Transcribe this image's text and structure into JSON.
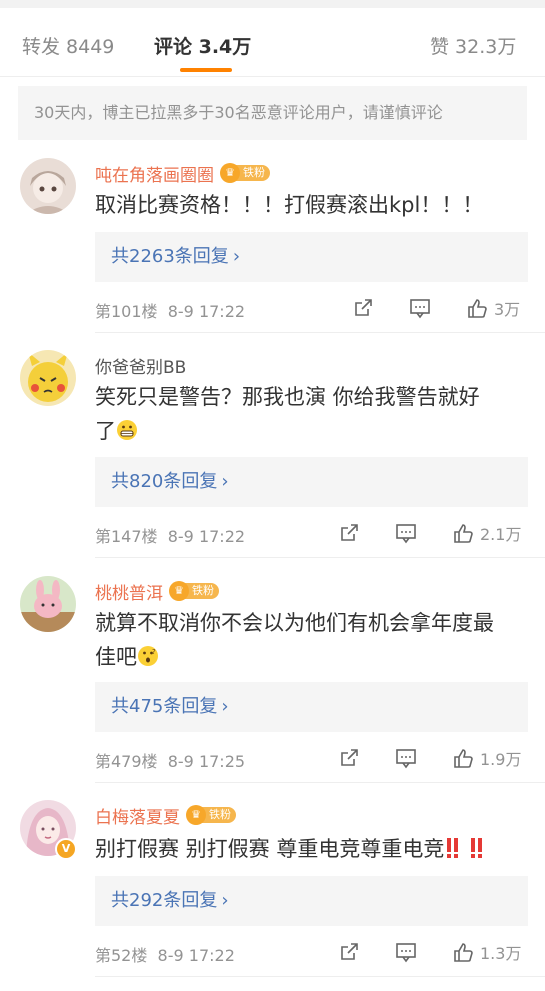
{
  "tabs": {
    "repost": "转发 8449",
    "comment": "评论 3.4万",
    "like": "赞 32.3万"
  },
  "notice": "30天内，博主已拉黑多于30名恶意评论用户，请谨慎评论",
  "fan_badge": "铁粉",
  "colors": {
    "accent": "#ff8200",
    "name": "#eb7350",
    "link": "#4a74b5"
  },
  "comments": [
    {
      "name": "吨在角落画圈圈",
      "fan": true,
      "text": "取消比赛资格！！！打假赛滚出kpl！！！",
      "replies": "共2263条回复",
      "floor": "第101楼",
      "time": "8-9 17:22",
      "likes": "3万"
    },
    {
      "name": "你爸爸别BB",
      "fan": false,
      "text1": "笑死只是警告？那我也演 你给我警告就好",
      "text2": "了",
      "emoji": "grin-emoji",
      "replies": "共820条回复",
      "floor": "第147楼",
      "time": "8-9 17:22",
      "likes": "2.1万"
    },
    {
      "name": "桃桃普洱",
      "fan": true,
      "text1": "就算不取消你不会以为他们有机会拿年度最",
      "text2": "佳吧",
      "emoji": "thinking-emoji",
      "replies": "共475条回复",
      "floor": "第479楼",
      "time": "8-9 17:25",
      "likes": "1.9万"
    },
    {
      "name": "白梅落夏夏",
      "fan": true,
      "verified": "V",
      "text": "别打假赛 别打假赛 尊重电竞尊重电竞",
      "emoji": "double-exclamation-emoji",
      "replies": "共292条回复",
      "floor": "第52楼",
      "time": "8-9 17:22",
      "likes": "1.3万"
    }
  ]
}
